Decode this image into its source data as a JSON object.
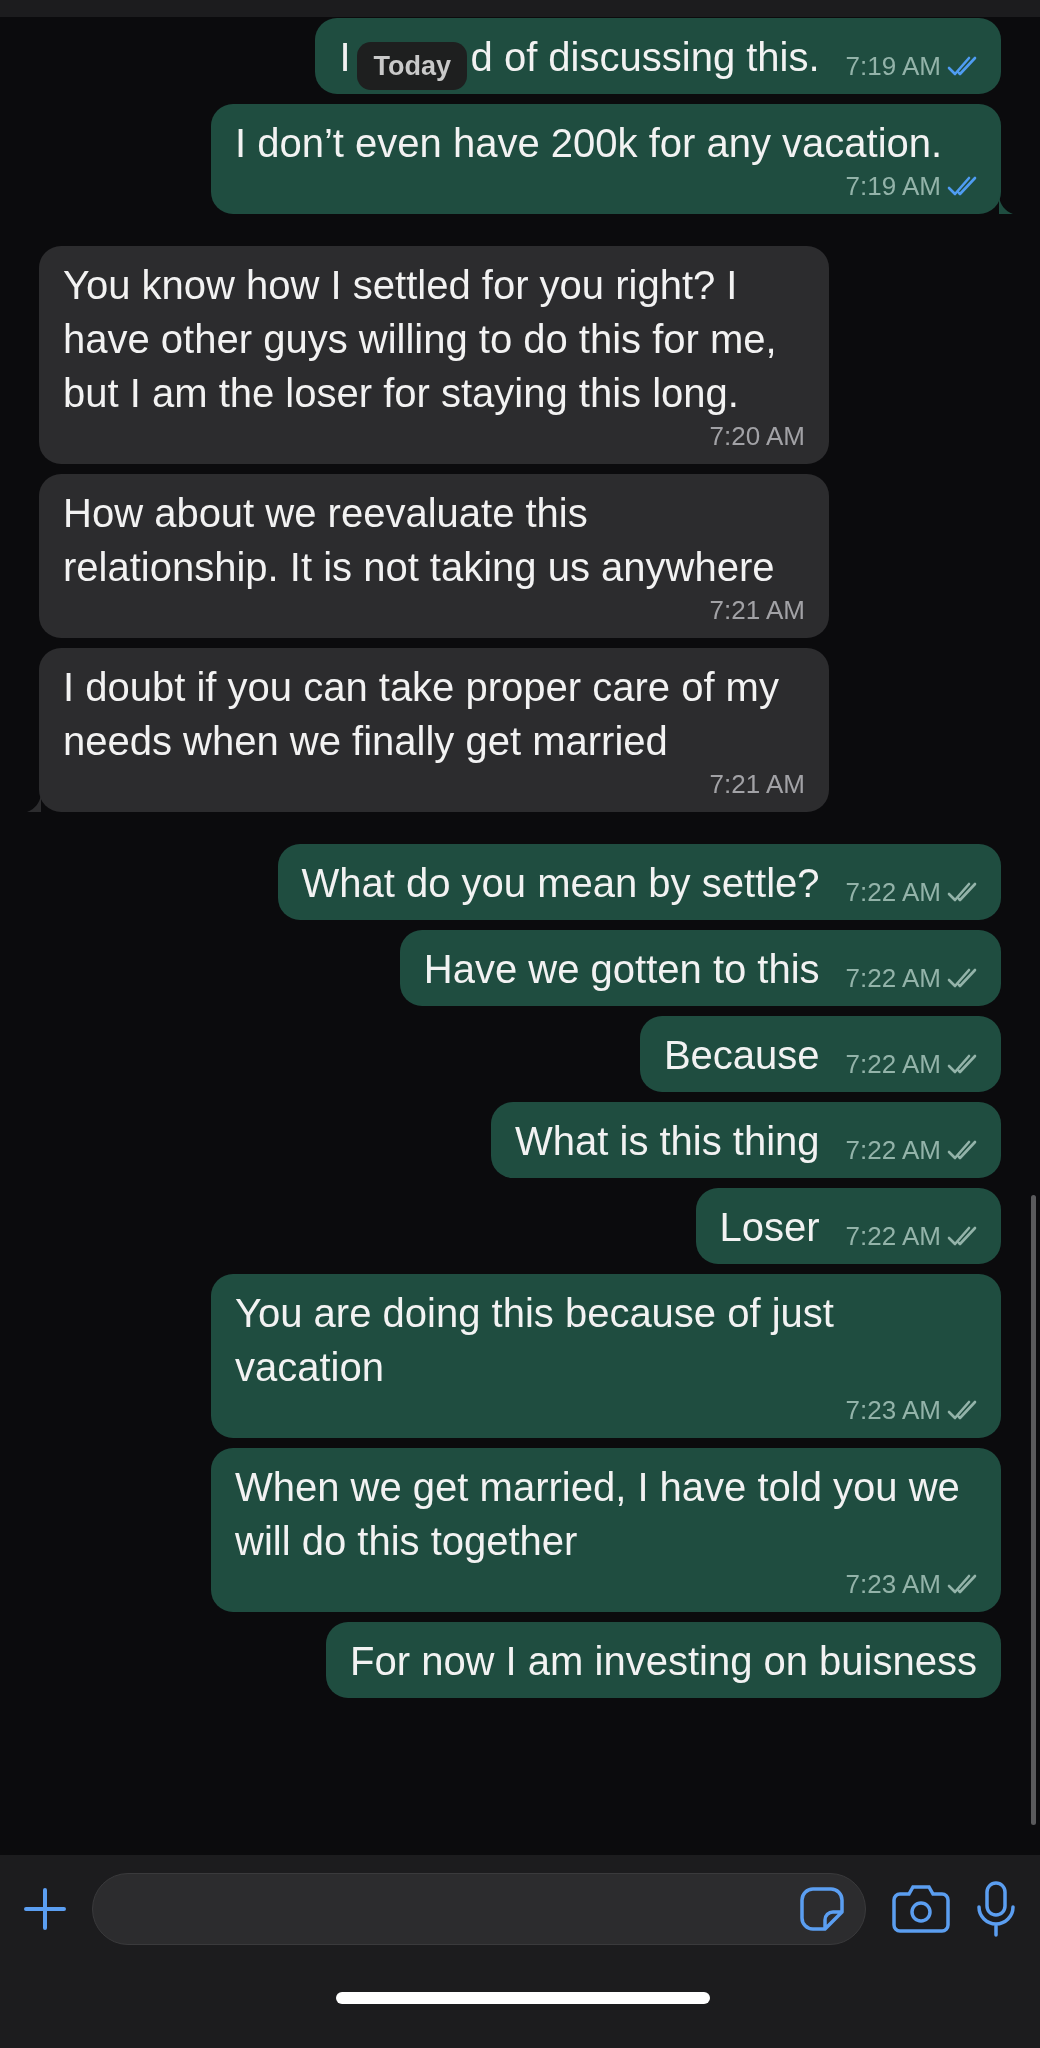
{
  "date_chip": {
    "label": "Today"
  },
  "messages": [
    {
      "kind": "outgoing",
      "text_parts": [
        "I",
        "d of discussing this."
      ],
      "time": "7:19 AM",
      "read": true
    },
    {
      "kind": "outgoing",
      "text": "I don’t even have 200k for any vacation.",
      "time": "7:19 AM",
      "read": true,
      "tail": true
    },
    {
      "kind": "incoming",
      "text": "You know how I settled for you right? I have other guys willing to do this for me, but I am the loser for staying this long.",
      "time": "7:20 AM"
    },
    {
      "kind": "incoming",
      "text": "How about we reevaluate this relationship. It is not taking us anywhere",
      "time": "7:21 AM"
    },
    {
      "kind": "incoming",
      "text": "I doubt if you can take proper care of my needs when we finally get married",
      "time": "7:21 AM",
      "tail": true
    },
    {
      "kind": "outgoing",
      "text": "What do you mean by settle?",
      "time": "7:22 AM",
      "read": false
    },
    {
      "kind": "outgoing",
      "text": "Have we gotten to this",
      "time": "7:22 AM",
      "read": false
    },
    {
      "kind": "outgoing",
      "text": "Because",
      "time": "7:22 AM",
      "read": false
    },
    {
      "kind": "outgoing",
      "text": "What is this thing",
      "time": "7:22 AM",
      "read": false
    },
    {
      "kind": "outgoing",
      "text": "Loser",
      "time": "7:22 AM",
      "read": false
    },
    {
      "kind": "outgoing",
      "text": "You are doing this because of just vacation",
      "time": "7:23 AM",
      "read": false
    },
    {
      "kind": "outgoing",
      "text": "When we get married, I have told you we will do this together",
      "time": "7:23 AM",
      "read": false
    },
    {
      "kind": "outgoing",
      "text": "For now I am investing on buisness"
    }
  ]
}
